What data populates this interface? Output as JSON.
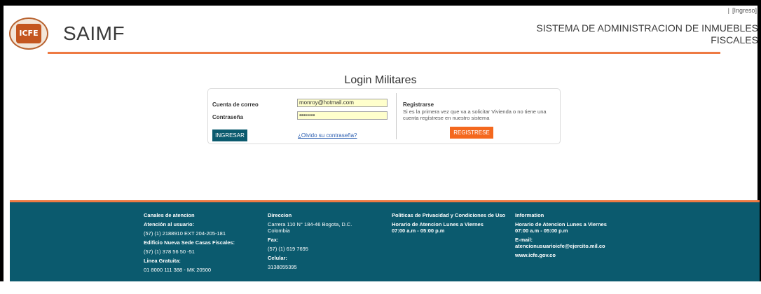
{
  "top_nav": {
    "separator": "|",
    "login_link": "[Ingreso]"
  },
  "header": {
    "logo_text": "ICFE",
    "app_name": "SAIMF",
    "system_title": "SISTEMA DE ADMINISTRACION DE INMUEBLES FISCALES"
  },
  "login": {
    "title": "Login Militares",
    "email_label": "Cuenta de correo",
    "email_value": "monroy@hotmail.com",
    "password_label": "Contraseña",
    "password_value": "••••••••",
    "submit_label": "INGRESAR",
    "forgot_link": "¿Olvido su contraseña?"
  },
  "register": {
    "title": "Registrarse",
    "description": "Si es la primera vez que va a solicitar Vivienda o no tiene una cuenta regístrese en nuestro sistema",
    "button_label": "REGISTRESE"
  },
  "footer": {
    "col1": {
      "title": "Canales de atencion",
      "line1": "Atención al usuario:",
      "line2": "(57) (1) 2188910 EXT 204-205-181",
      "line3": "Edificio Nueva Sede Casas Fiscales:",
      "line4": "(57) (1) 378 56 50 -51",
      "line5": "Linea Gratuita:",
      "line6": "01 8000 111 388 - MK 20500"
    },
    "col2": {
      "title": "Direccion",
      "line1": "Carrera 110 N° 184-46 Bogota, D.C.",
      "line2": "Colombia",
      "line3": "Fax:",
      "line4": "(57) (1) 619 7695",
      "line5": "Celular:",
      "line6": "3138055395"
    },
    "col3": {
      "title": "Politicas de Privacidad y Condiciones de Uso",
      "line1": "Horario de Atencion Lunes a Viernes",
      "line2": "07:00 a.m - 05:00 p.m"
    },
    "col4": {
      "title": "Information",
      "line1": "Horario de Atencion Lunes a Viernes",
      "line2": "07:00 a.m - 05:00 p.m",
      "line3": "E-mail:",
      "line4": "atencionusuarioicfe@ejercito.mil.co",
      "line5": "www.icfe.gov.co"
    }
  },
  "colors": {
    "accent": "#ee7a43",
    "footer_bg": "#0b5a6e",
    "register_button": "#f4681e",
    "input_bg": "#ffffcc"
  }
}
